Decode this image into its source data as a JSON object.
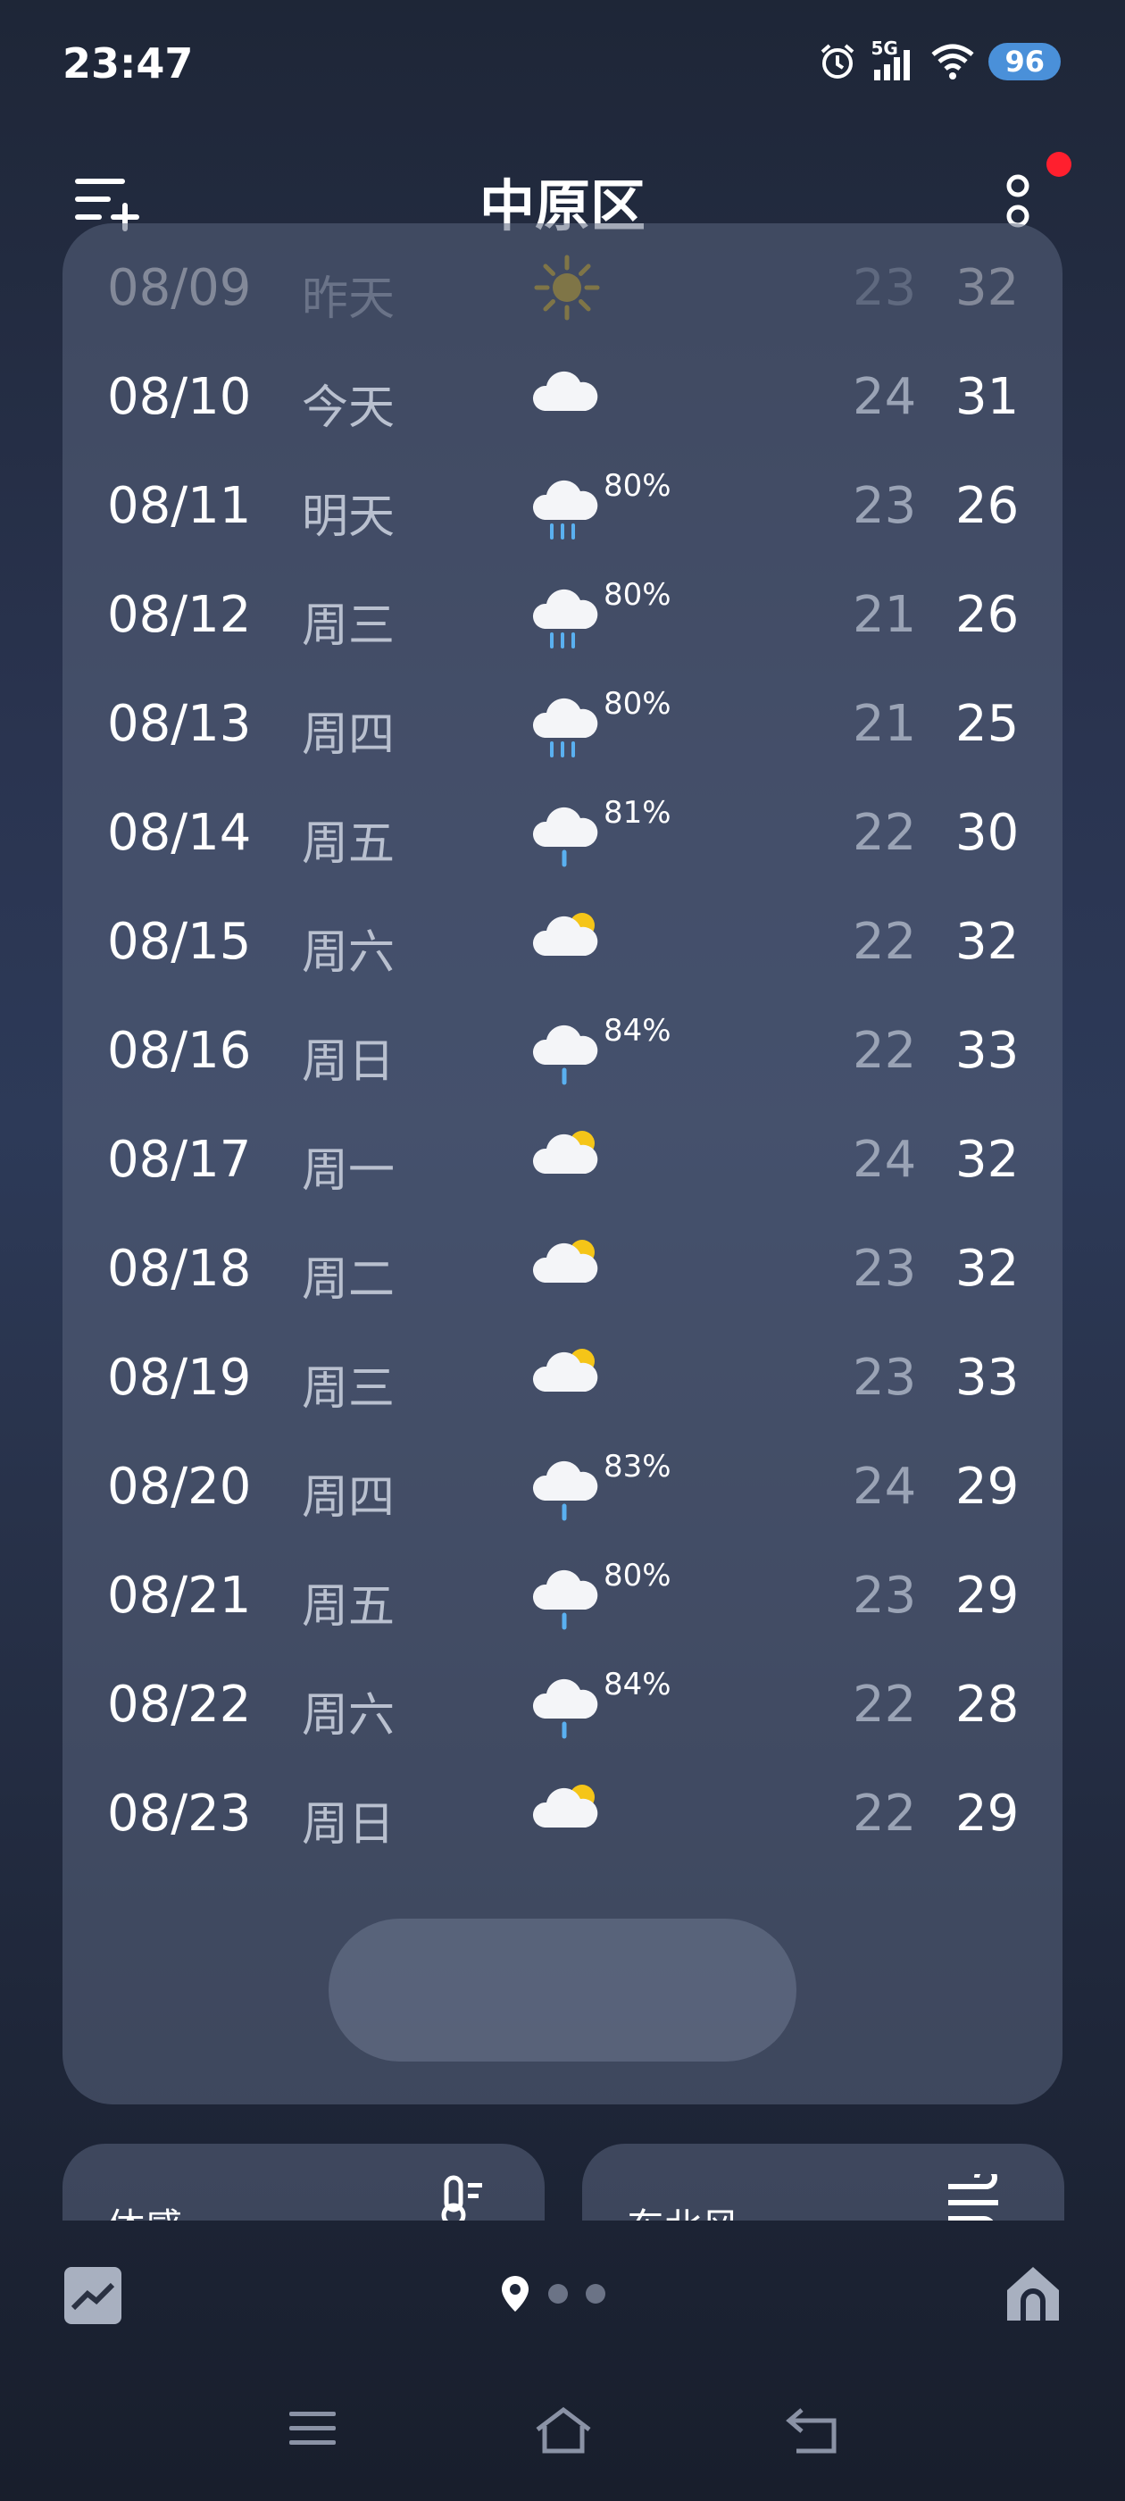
{
  "status": {
    "time": "23:47",
    "network": "5G",
    "battery": "96"
  },
  "header": {
    "city": "中原区"
  },
  "forecast": [
    {
      "date": "08/09",
      "day": "昨天",
      "icon": "sunny-icon",
      "precip": "",
      "low": "23",
      "high": "32",
      "faded": true
    },
    {
      "date": "08/10",
      "day": "今天",
      "icon": "cloudy-icon",
      "precip": "",
      "low": "24",
      "high": "31"
    },
    {
      "date": "08/11",
      "day": "明天",
      "icon": "heavy-rain-icon",
      "precip": "80%",
      "low": "23",
      "high": "26"
    },
    {
      "date": "08/12",
      "day": "周三",
      "icon": "heavy-rain-icon",
      "precip": "80%",
      "low": "21",
      "high": "26"
    },
    {
      "date": "08/13",
      "day": "周四",
      "icon": "heavy-rain-icon",
      "precip": "80%",
      "low": "21",
      "high": "25"
    },
    {
      "date": "08/14",
      "day": "周五",
      "icon": "light-rain-icon",
      "precip": "81%",
      "low": "22",
      "high": "30"
    },
    {
      "date": "08/15",
      "day": "周六",
      "icon": "partly-cloudy-icon",
      "precip": "",
      "low": "22",
      "high": "32"
    },
    {
      "date": "08/16",
      "day": "周日",
      "icon": "light-rain-icon",
      "precip": "84%",
      "low": "22",
      "high": "33"
    },
    {
      "date": "08/17",
      "day": "周一",
      "icon": "partly-cloudy-icon",
      "precip": "",
      "low": "24",
      "high": "32"
    },
    {
      "date": "08/18",
      "day": "周二",
      "icon": "partly-cloudy-icon",
      "precip": "",
      "low": "23",
      "high": "32"
    },
    {
      "date": "08/19",
      "day": "周三",
      "icon": "partly-cloudy-icon",
      "precip": "",
      "low": "23",
      "high": "33"
    },
    {
      "date": "08/20",
      "day": "周四",
      "icon": "light-rain-icon",
      "precip": "83%",
      "low": "24",
      "high": "29"
    },
    {
      "date": "08/21",
      "day": "周五",
      "icon": "light-rain-icon",
      "precip": "80%",
      "low": "23",
      "high": "29"
    },
    {
      "date": "08/22",
      "day": "周六",
      "icon": "light-rain-icon",
      "precip": "84%",
      "low": "22",
      "high": "28"
    },
    {
      "date": "08/23",
      "day": "周日",
      "icon": "partly-cloudy-icon",
      "precip": "",
      "low": "22",
      "high": "29"
    }
  ],
  "cards": {
    "feels_like": "体感",
    "wind": "东北风"
  },
  "colors": {
    "sun": "#f5c518",
    "alert": "#ff1f2e",
    "battery": "#4a90d9",
    "rain": "#5ab0f0"
  }
}
